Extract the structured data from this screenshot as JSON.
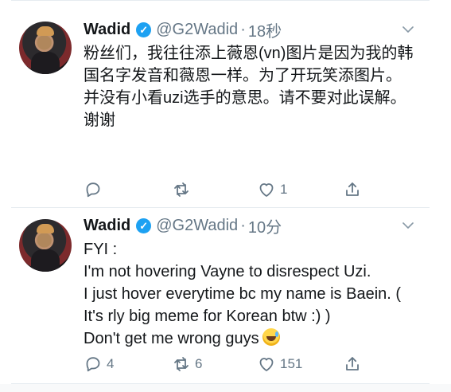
{
  "tweets": [
    {
      "name": "Wadid",
      "handle": "@G2Wadid",
      "separator": "·",
      "time": "18秒",
      "text": "粉丝们，我往往添上薇恩(vn)图片是因为我的韩国名字发音和薇恩一样。为了开玩笑添图片。\n并没有小看uzi选手的意思。请不要对此误解。\n谢谢",
      "reply_count": "",
      "retweet_count": "",
      "like_count": "1"
    },
    {
      "name": "Wadid",
      "handle": "@G2Wadid",
      "separator": "·",
      "time": "10分",
      "text": "FYI :\nI'm not hovering Vayne to disrespect Uzi.\nI just hover everytime bc my name is Baein. ( It's rly big meme for Korean btw :) )\nDon't get me wrong guys",
      "reply_count": "4",
      "retweet_count": "6",
      "like_count": "151",
      "emoji": "sweat-smile"
    }
  ],
  "colors": {
    "accent": "#1da1f2",
    "muted": "#657786",
    "text": "#14171a",
    "border": "#e6ecf0"
  },
  "icons": [
    "verified-badge-icon",
    "chevron-down-icon",
    "reply-icon",
    "retweet-icon",
    "heart-icon",
    "share-icon"
  ]
}
